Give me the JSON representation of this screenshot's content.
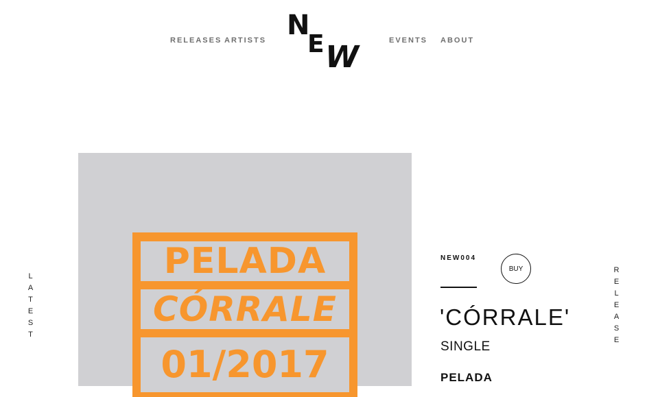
{
  "nav": {
    "releases": "RELEASES",
    "artists": "ARTISTS",
    "events": "EVENTS",
    "about": "ABOUT"
  },
  "logo": {
    "letters": [
      "N",
      "E",
      "W"
    ]
  },
  "side_left": {
    "letters": [
      "L",
      "A",
      "T",
      "E",
      "S",
      "T"
    ]
  },
  "side_right": {
    "letters": [
      "R",
      "E",
      "L",
      "E",
      "A",
      "S",
      "E"
    ]
  },
  "cover": {
    "line1": "PELADA",
    "line2": "CÓRRALE",
    "line3": "01/2017",
    "colors": {
      "background": "#d0d0d3",
      "accent": "#f7962e"
    }
  },
  "release": {
    "code": "NEW004",
    "buy_label": "BUY",
    "title": "'CÓRRALE'",
    "type": "SINGLE",
    "artist": "PELADA"
  }
}
